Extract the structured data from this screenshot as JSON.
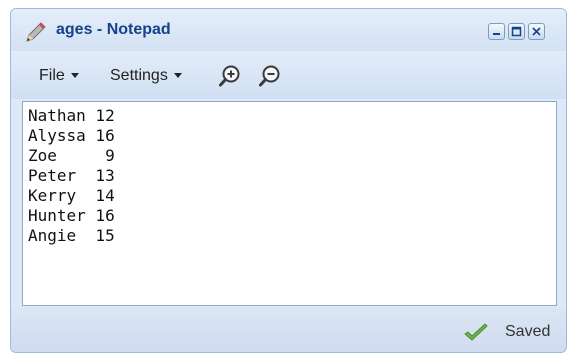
{
  "window": {
    "title": "ages - Notepad",
    "icon": "pencil-icon",
    "controls": [
      "minimize-icon",
      "maximize-icon",
      "close-icon"
    ]
  },
  "toolbar": {
    "file_label": "File",
    "settings_label": "Settings",
    "zoom_in_icon": "zoom-in-icon",
    "zoom_out_icon": "zoom-out-icon"
  },
  "editor": {
    "content": "Nathan 12\nAlyssa 16\nZoe     9\nPeter  13\nKerry  14\nHunter 16\nAngie  15"
  },
  "status": {
    "text": "Saved",
    "icon": "checkmark-icon",
    "icon_color": "#6bb34b"
  },
  "colors": {
    "title_text": "#15428b",
    "window_border": "#99bbe8",
    "chrome_background": "#dfe8f6"
  }
}
